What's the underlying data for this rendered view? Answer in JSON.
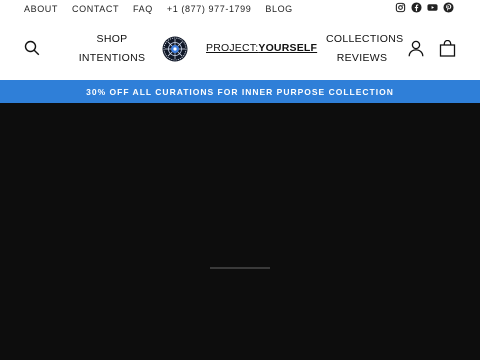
{
  "topbar": {
    "links": [
      "ABOUT",
      "CONTACT",
      "FAQ",
      "+1 (877) 977-1799",
      "BLOG"
    ],
    "social": [
      "instagram-icon",
      "facebook-icon",
      "youtube-icon",
      "pinterest-icon"
    ]
  },
  "header": {
    "nav_left": [
      "SHOP",
      "INTENTIONS"
    ],
    "nav_right": [
      "COLLECTIONS",
      "REVIEWS"
    ],
    "logo_prefix": "PROJECT:",
    "logo_bold": "YOURSELF",
    "icons": [
      "search-icon",
      "account-icon",
      "cart-icon"
    ]
  },
  "announcement": {
    "text": "30% OFF ALL CURATIONS FOR INNER PURPOSE COLLECTION",
    "color": "#2f7fd8"
  },
  "hero": {
    "background": "#0d0d0d"
  }
}
